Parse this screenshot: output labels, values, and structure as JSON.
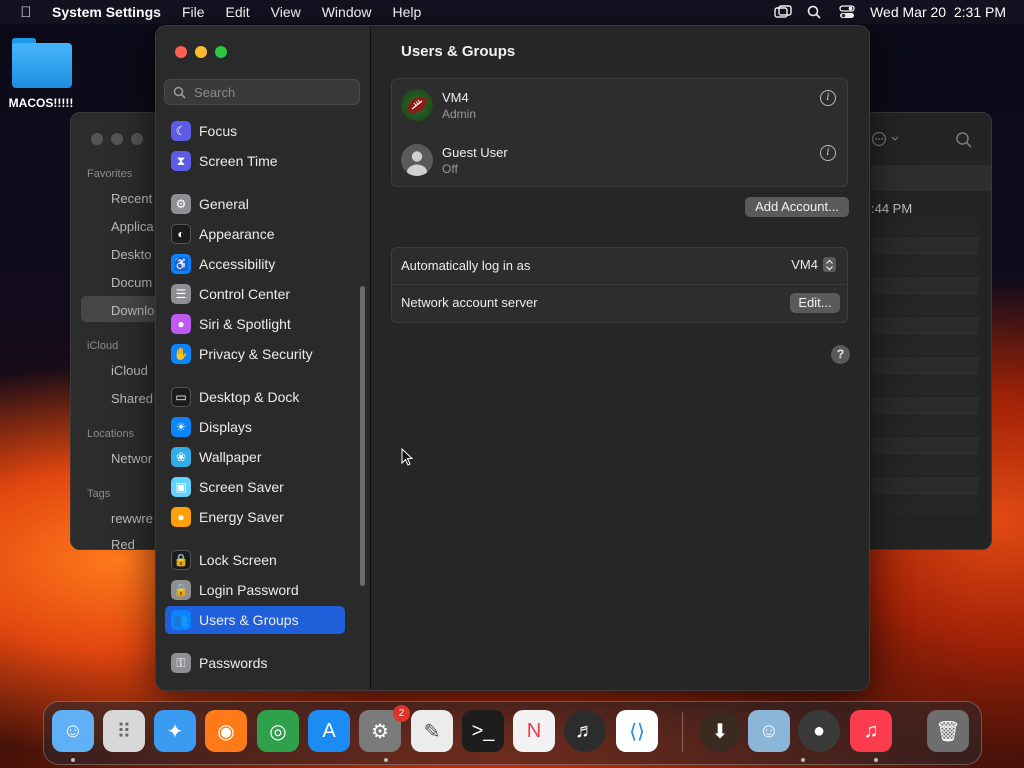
{
  "menubar": {
    "app_name": "System Settings",
    "menus": [
      "File",
      "Edit",
      "View",
      "Window",
      "Help"
    ],
    "datetime": "Wed Mar 20  2:31 PM"
  },
  "desktop": {
    "folder_label": "MACOS!!!!!"
  },
  "finder": {
    "sections": [
      "Favorites",
      "iCloud",
      "Locations",
      "Tags"
    ],
    "favorites": [
      "Recent",
      "Applica",
      "Deskto",
      "Docum",
      "Downlo"
    ],
    "icloud": [
      "iCloud",
      "Shared"
    ],
    "locations": [
      "Networ"
    ],
    "tags": [
      "rewwre",
      "Red"
    ],
    "time": ":44 PM"
  },
  "search": {
    "placeholder": "Search"
  },
  "sidebar": {
    "items": [
      {
        "label": "Focus",
        "icon": "moon-icon",
        "color": "#5e5ce6"
      },
      {
        "label": "Screen Time",
        "icon": "hourglass-icon",
        "color": "#5e5ce6"
      },
      {
        "label": "General",
        "icon": "gear-icon",
        "color": "#8e8e93"
      },
      {
        "label": "Appearance",
        "icon": "appearance-icon",
        "color": "#1c1c1e"
      },
      {
        "label": "Accessibility",
        "icon": "accessibility-icon",
        "color": "#0a84ff"
      },
      {
        "label": "Control Center",
        "icon": "control-center-icon",
        "color": "#8e8e93"
      },
      {
        "label": "Siri & Spotlight",
        "icon": "siri-icon",
        "color": "#bf5af2"
      },
      {
        "label": "Privacy & Security",
        "icon": "hand-icon",
        "color": "#0a84ff"
      },
      {
        "label": "Desktop & Dock",
        "icon": "dock-icon",
        "color": "#1c1c1e"
      },
      {
        "label": "Displays",
        "icon": "sun-icon",
        "color": "#0a84ff"
      },
      {
        "label": "Wallpaper",
        "icon": "wallpaper-icon",
        "color": "#32ade6"
      },
      {
        "label": "Screen Saver",
        "icon": "screensaver-icon",
        "color": "#64d2ff"
      },
      {
        "label": "Energy Saver",
        "icon": "bulb-icon",
        "color": "#ff9f0a"
      },
      {
        "label": "Lock Screen",
        "icon": "lock-icon",
        "color": "#1c1c1e"
      },
      {
        "label": "Login Password",
        "icon": "padlock-icon",
        "color": "#8e8e93"
      },
      {
        "label": "Users & Groups",
        "icon": "users-icon",
        "color": "#0a84ff"
      },
      {
        "label": "Passwords",
        "icon": "key-icon",
        "color": "#8e8e93"
      }
    ]
  },
  "content": {
    "title": "Users & Groups",
    "users": [
      {
        "name": "VM4",
        "role": "Admin"
      },
      {
        "name": "Guest User",
        "role": "Off"
      }
    ],
    "add_account_label": "Add Account...",
    "auto_login_label": "Automatically log in as",
    "auto_login_value": "VM4",
    "network_server_label": "Network account server",
    "edit_label": "Edit...",
    "help_label": "?"
  },
  "dock": {
    "apps": [
      "Finder",
      "Launchpad",
      "Safari",
      "Firefox",
      "Chrome",
      "App Store",
      "System Settings",
      "TextEdit",
      "Terminal",
      "News",
      "GarageBand",
      "VS Code",
      "Downloads",
      "Finder",
      "Window",
      "Music",
      "Trash"
    ],
    "settings_badge": "2"
  }
}
